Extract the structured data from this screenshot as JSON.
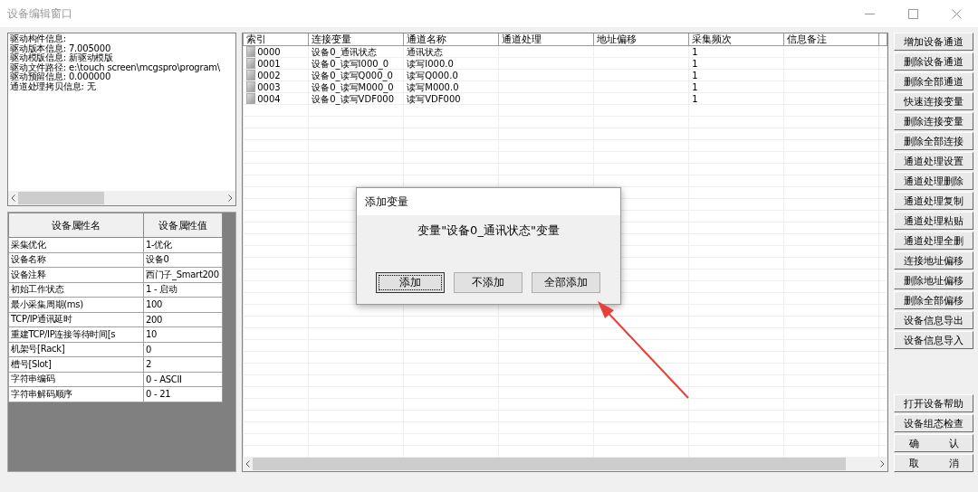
{
  "window": {
    "title": "设备编辑窗口"
  },
  "driver_info": {
    "lines": [
      "驱动构件信息:",
      "驱动版本信息: 7.005000",
      "驱动模版信息: 新驱动模版",
      "驱动文件路径: e:\\touch screen\\mcgspro\\program\\",
      "驱动预留信息: 0.000000",
      "通道处理拷贝信息: 无"
    ]
  },
  "properties": {
    "columns": [
      "设备属性名",
      "设备属性值"
    ],
    "rows": [
      {
        "name": "采集优化",
        "value": "1-优化"
      },
      {
        "name": "设备名称",
        "value": "设备0"
      },
      {
        "name": "设备注释",
        "value": "西门子_Smart200"
      },
      {
        "name": "初始工作状态",
        "value": "1 - 启动"
      },
      {
        "name": "最小采集周期(ms)",
        "value": "100"
      },
      {
        "name": "TCP/IP通讯延时",
        "value": "200"
      },
      {
        "name": "重建TCP/IP连接等待时间[s",
        "value": "10"
      },
      {
        "name": "机架号[Rack]",
        "value": "0"
      },
      {
        "name": "槽号[Slot]",
        "value": "2"
      },
      {
        "name": "字符串编码",
        "value": "0 - ASCII"
      },
      {
        "name": "字符串解码顺序",
        "value": "0 - 21"
      }
    ]
  },
  "channels": {
    "columns": [
      "索引",
      "连接变量",
      "通道名称",
      "通道处理",
      "地址偏移",
      "采集频次",
      "信息备注"
    ],
    "rows": [
      {
        "index": "0000",
        "variable": "设备0_通讯状态",
        "channel_name": "通讯状态",
        "frequency": "1"
      },
      {
        "index": "0001",
        "variable": "设备0_读写I000_0",
        "channel_name": "读写I000.0",
        "frequency": "1"
      },
      {
        "index": "0002",
        "variable": "设备0_读写Q000_0",
        "channel_name": "读写Q000.0",
        "frequency": "1"
      },
      {
        "index": "0003",
        "variable": "设备0_读写M000_0",
        "channel_name": "读写M000.0",
        "frequency": "1"
      },
      {
        "index": "0004",
        "variable": "设备0_读写VDF000",
        "channel_name": "读写VDF000",
        "frequency": "1"
      }
    ]
  },
  "side_buttons": [
    "增加设备通道",
    "删除设备通道",
    "删除全部通道",
    "快速连接变量",
    "删除连接变量",
    "删除全部连接",
    "通道处理设置",
    "通道处理删除",
    "通道处理复制",
    "通道处理粘贴",
    "通道处理全删",
    "连接地址偏移",
    "删除地址偏移",
    "删除全部偏移",
    "设备信息导出",
    "设备信息导入"
  ],
  "bottom_buttons": [
    "打开设备帮助",
    "设备组态检查",
    "确　　　认",
    "取　　　消"
  ],
  "dialog": {
    "title": "添加变量",
    "message": "变量\"设备0_通讯状态\"变量",
    "buttons": [
      {
        "label": "添加",
        "focused": true
      },
      {
        "label": "不添加",
        "focused": false
      },
      {
        "label": "全部添加",
        "focused": false
      }
    ]
  }
}
